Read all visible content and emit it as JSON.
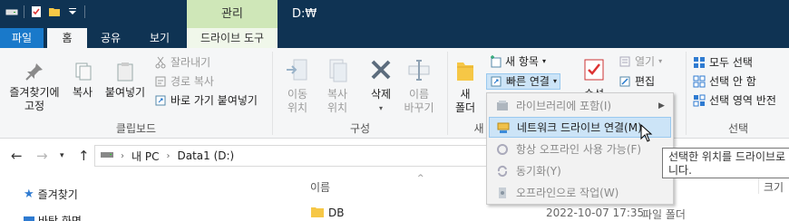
{
  "titlebar": {
    "context_group": "관리",
    "title": "D:₩"
  },
  "tabs": {
    "file": "파일",
    "home": "홈",
    "share": "공유",
    "view": "보기",
    "drive_tools": "드라이브 도구"
  },
  "ribbon": {
    "clipboard": {
      "pin_label_1": "즐겨찾기에",
      "pin_label_2": "고정",
      "copy": "복사",
      "paste": "붙여넣기",
      "cut": "잘라내기",
      "copy_path": "경로 복사",
      "paste_shortcut": "바로 가기 붙여넣기",
      "group_label": "클립보드"
    },
    "organize": {
      "move_1": "이동",
      "move_2": "위치",
      "copy_1": "복사",
      "copy_2": "위치",
      "delete": "삭제",
      "rename_1": "이름",
      "rename_2": "바꾸기",
      "group_label": "구성"
    },
    "new": {
      "new_folder_1": "새",
      "new_folder_2": "폴더",
      "new_item": "새 항목",
      "easy_access": "빠른 연결",
      "group_label": "새"
    },
    "open": {
      "properties": "속성",
      "open": "열기",
      "edit": "편집"
    },
    "select": {
      "select_all": "모두 선택",
      "select_none": "선택 안 함",
      "invert": "선택 영역 반전",
      "group_label": "선택"
    }
  },
  "easy_access_menu": {
    "items": [
      {
        "label": "라이브러리에 포함(I)",
        "icon": "library-icon",
        "state": "disabled"
      },
      {
        "label": "네트워크 드라이브 연결(M)",
        "icon": "network-drive-icon",
        "state": "highlighted"
      },
      {
        "label": "항상 오프라인 사용 가능(F)",
        "icon": "sync-icon",
        "state": "disabled"
      },
      {
        "label": "동기화(Y)",
        "icon": "sync-icon",
        "state": "disabled"
      },
      {
        "label": "오프라인으로 작업(W)",
        "icon": "offline-icon",
        "state": "disabled"
      }
    ]
  },
  "tooltip": {
    "line1": "선택한 위치를 드라이브로",
    "line2": "니다."
  },
  "address": {
    "crumbs": [
      "내 PC",
      "Data1 (D:)"
    ]
  },
  "nav_pane": {
    "favorites": "즐겨찾기",
    "desktop_partial": "바탕 화면"
  },
  "file_list": {
    "header_name": "이름",
    "header_size": "크기",
    "rows": [
      {
        "name": "DB",
        "date": "2022-10-07 17:35",
        "type": "파일 폴더"
      }
    ]
  },
  "colors": {
    "titlebar": "#0f3353",
    "file_tab": "#1979ca",
    "context_group": "#cfe7b8",
    "menu_highlight": "#cce4f7"
  }
}
